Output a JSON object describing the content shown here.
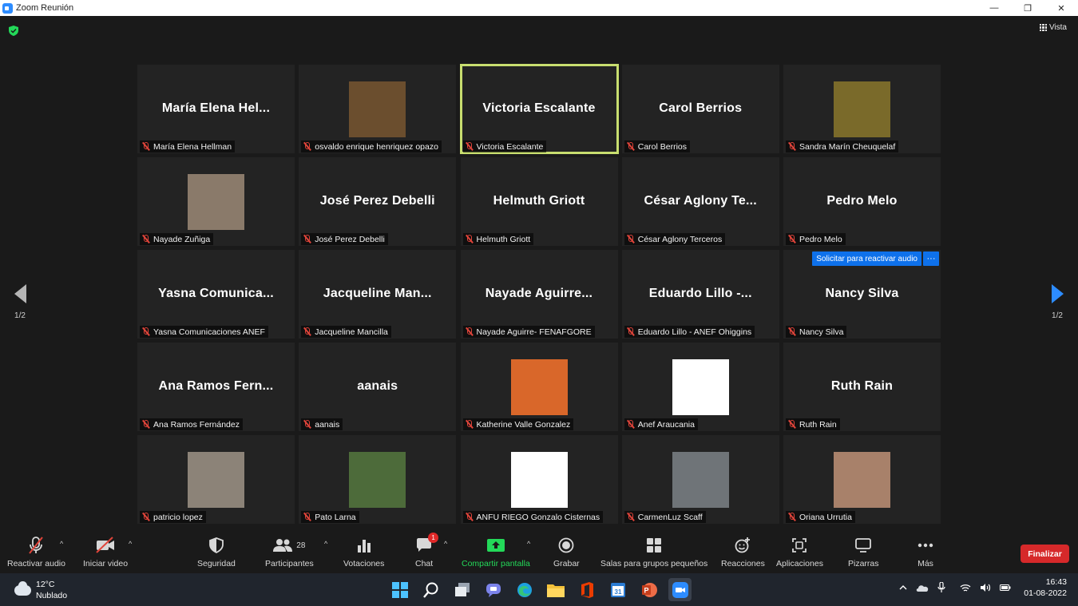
{
  "window": {
    "title": "Zoom Reunión",
    "minimize": "—",
    "restore": "❐",
    "close": "✕"
  },
  "meeting": {
    "view_label": "Vista",
    "page_left": "1/2",
    "page_right": "1/2",
    "audio_request_label": "Solicitar para reactivar audio",
    "audio_request_more": "···",
    "tiles": [
      {
        "big": "María Elena Hel...",
        "label": "María Elena Hellman"
      },
      {
        "big": "",
        "label": "osvaldo enrique henriquez opazo",
        "photo": "#6b4e2e"
      },
      {
        "big": "Victoria Escalante",
        "label": "Victoria Escalante",
        "active": true
      },
      {
        "big": "Carol Berrios",
        "label": "Carol Berrios"
      },
      {
        "big": "",
        "label": "Sandra Marín Cheuquelaf",
        "photo": "#7a6a2a"
      },
      {
        "big": "",
        "label": "Nayade Zuñiga",
        "photo": "#8a7a6a"
      },
      {
        "big": "José Perez Debelli",
        "label": "José Perez Debelli"
      },
      {
        "big": "Helmuth Griott",
        "label": "Helmuth Griott"
      },
      {
        "big": "César Aglony Te...",
        "label": "César Aglony Terceros"
      },
      {
        "big": "Pedro Melo",
        "label": "Pedro Melo"
      },
      {
        "big": "Yasna Comunica...",
        "label": "Yasna Comunicaciones ANEF"
      },
      {
        "big": "Jacqueline Man...",
        "label": "Jacqueline Mancilla"
      },
      {
        "big": "Nayade Aguirre...",
        "label": "Nayade Aguirre- FENAFGORE"
      },
      {
        "big": "Eduardo Lillo -...",
        "label": "Eduardo Lillo - ANEF Ohiggins"
      },
      {
        "big": "Nancy Silva",
        "label": "Nancy Silva",
        "audio_request": true
      },
      {
        "big": "Ana Ramos Fern...",
        "label": "Ana Ramos Fernández"
      },
      {
        "big": "aanais",
        "label": "aanais"
      },
      {
        "big": "",
        "label": "Katherine Valle Gonzalez",
        "photo": "#d9672a"
      },
      {
        "big": "",
        "label": "Anef Araucania",
        "photo": "#ffffff"
      },
      {
        "big": "Ruth Rain",
        "label": "Ruth Rain"
      },
      {
        "big": "",
        "label": "patricio lopez",
        "photo": "#8c8378"
      },
      {
        "big": "",
        "label": "Pato Larna",
        "photo": "#4d6b3a"
      },
      {
        "big": "",
        "label": "ANFU RIEGO Gonzalo Cisternas",
        "photo": "#ffffff"
      },
      {
        "big": "",
        "label": "CarmenLuz Scaff",
        "photo": "#6f7478"
      },
      {
        "big": "",
        "label": "Oriana Urrutia",
        "photo": "#a8816a"
      }
    ]
  },
  "toolbar": {
    "unmute": "Reactivar audio",
    "start_video": "Iniciar video",
    "security": "Seguridad",
    "participants": "Participantes",
    "participants_count": "28",
    "polls": "Votaciones",
    "chat": "Chat",
    "chat_badge": "1",
    "share": "Compartir pantalla",
    "record": "Grabar",
    "breakout": "Salas para grupos pequeños",
    "reactions": "Reacciones",
    "apps": "Aplicaciones",
    "whiteboards": "Pizarras",
    "more": "Más",
    "end": "Finalizar"
  },
  "taskbar": {
    "temperature": "12°C",
    "weather": "Nublado",
    "time": "16:43",
    "date": "01-08-2022",
    "calendar_day": "31"
  },
  "colors": {
    "accent": "#2d8cff",
    "active_speaker": "#c8de6f",
    "end_red": "#d6292a",
    "share_green": "#23d959"
  }
}
